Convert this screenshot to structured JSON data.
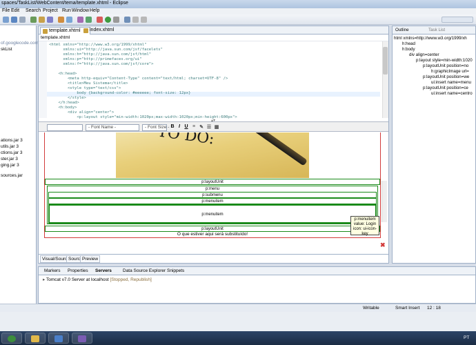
{
  "window": {
    "title": "spaces/TaskList/WebContent/tema/template.xhtml - Eclipse"
  },
  "menu": [
    "File",
    "Edit",
    "Search",
    "Project",
    "Run",
    "Window",
    "Help"
  ],
  "left_pane": {
    "items": [
      "of.googlecode.com",
      "skList",
      "ations.jar 3",
      "utils.jar 3",
      "ctions.jar 3",
      "ster.jar 3",
      "ging.jar 3",
      "sources.jar"
    ]
  },
  "editor": {
    "tabs": [
      "template.xhtml",
      "index.xhtml"
    ],
    "breadcrumb": "template.xhtml",
    "code_lines": [
      "<html xmlns=\"http://www.w3.org/1999/xhtml\"",
      "      xmlns:ui=\"http://java.sun.com/jsf/facelets\"",
      "      xmlns:h=\"http://java.sun.com/jsf/html\"",
      "      xmlns:p=\"http://primefaces.org/ui\"",
      "      xmlns:f=\"http://java.sun.com/jsf/core\">",
      "",
      "    <h:head>",
      "        <meta http-equiv=\"Content-Type\" content=\"text/html; charset=UTF-8\" />",
      "        <title>Meu Sistema</title>",
      "        <style type=\"text/css\">",
      "            body {background-color: #eeeeee; font-size: 12px}",
      "        </style>",
      "    </h:head>",
      "    <h:body>",
      "        <div align=\"center\">",
      "            <p:layout style=\"min-width:1020px;max-width:1020px;min-height:600px\">"
    ],
    "format_bar": {
      "font_name": "- Font Name -",
      "font_size": "- Font Size -",
      "bold": "B",
      "italic": "I",
      "underline": "U"
    },
    "design": {
      "photo_text": "TO DO:",
      "layout_unit_1": "p:layoutUnit",
      "menu": "p:menu",
      "submenu": "p:submenu",
      "menuitem_1": "p:menuitem",
      "menuitem_2": "p:menuitem",
      "layout_unit_2": "p:layoutUnit",
      "body_text": "O que estiver aqui será substituído!"
    },
    "tooltip": {
      "line1": "p:menuitem",
      "line2": "value: Login",
      "line3": "icon: ui-icon-key"
    },
    "bottom_tabs": [
      "Visual/Source",
      "Source",
      "Preview"
    ]
  },
  "outline": {
    "tabs": [
      "Outline",
      "Task List"
    ],
    "nodes": [
      "html xmlns=http://www.w3.org/1999/xh",
      "h:head",
      "h:body",
      "div align=center",
      "p:layout style=min-width:1020",
      "p:layoutUnit position=no",
      "h:graphicImage url=",
      "p:layoutUnit position=we",
      "ui:insert name=menu",
      "p:layoutUnit position=ce",
      "ui:insert name=centro"
    ]
  },
  "bottom_panel": {
    "tabs": [
      "Markers",
      "Properties",
      "Servers",
      "Data Source Explorer",
      "Snippets"
    ],
    "server_name": "Tomcat v7.0 Server at localhost",
    "server_status": "[Stopped, Republish]"
  },
  "status_bar": {
    "writable": "Writable",
    "insert_mode": "Smart Insert",
    "position": "12 : 18"
  },
  "taskbar": {
    "lang": "PT"
  }
}
